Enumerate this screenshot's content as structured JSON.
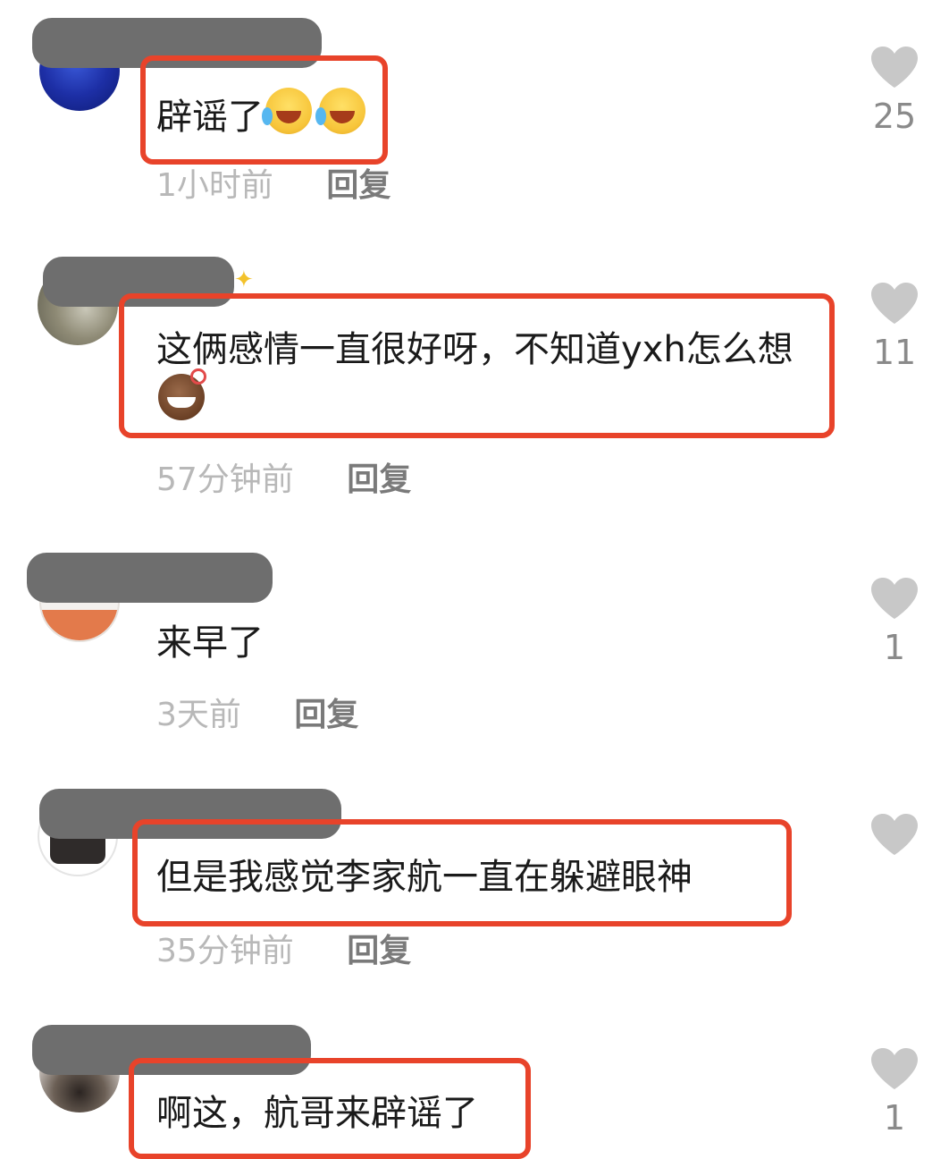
{
  "comments": [
    {
      "text_before": "辟谣了",
      "emojis": [
        "laugh-cry",
        "laugh-cry"
      ],
      "time": "1小时前",
      "reply": "回复",
      "likes": "25"
    },
    {
      "text_before": "这俩感情一直很好呀，不知道yxh怎么想",
      "emojis": [
        "grin"
      ],
      "time": "57分钟前",
      "reply": "回复",
      "likes": "11"
    },
    {
      "text_before": "来早了",
      "time": "3天前",
      "reply": "回复",
      "likes": "1"
    },
    {
      "text_before": "但是我感觉李家航一直在躲避眼神",
      "time": "35分钟前",
      "reply": "回复",
      "likes": ""
    },
    {
      "text_before": "啊这，航哥来辟谣了",
      "time": "",
      "reply": "",
      "likes": "1"
    }
  ],
  "colors": {
    "highlight": "#e8432a",
    "heart": "#c8c8c8",
    "name_mask": "#6e6e6e"
  },
  "icons": {
    "like": "heart-icon",
    "sparkle": "sparkle-icon"
  }
}
